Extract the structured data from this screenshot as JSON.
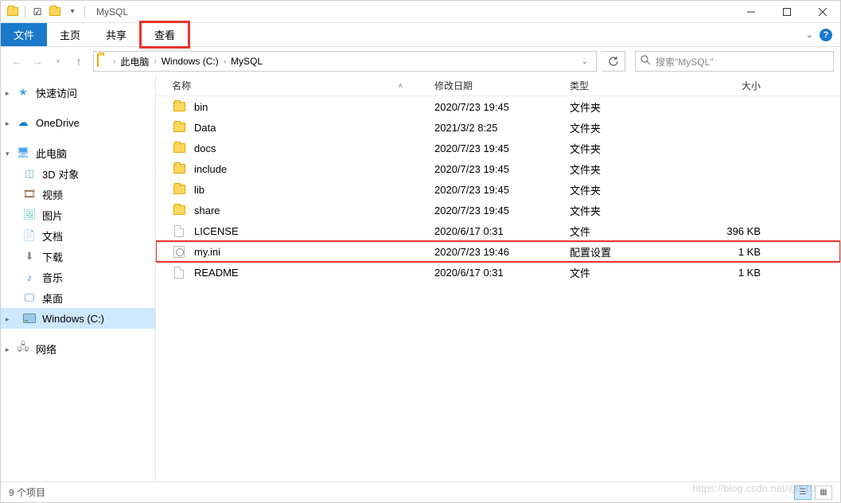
{
  "window": {
    "title": "MySQL"
  },
  "ribbon": {
    "file": "文件",
    "home": "主页",
    "share": "共享",
    "view": "查看"
  },
  "breadcrumb": {
    "segments": [
      "此电脑",
      "Windows  (C:)",
      "MySQL"
    ]
  },
  "search": {
    "placeholder": "搜索\"MySQL\""
  },
  "navpane": {
    "quick_access": "快速访问",
    "onedrive": "OneDrive",
    "this_pc": "此电脑",
    "objects_3d": "3D 对象",
    "videos": "视频",
    "pictures": "图片",
    "documents": "文档",
    "downloads": "下载",
    "music": "音乐",
    "desktop": "桌面",
    "drive_c": "Windows  (C:)",
    "network": "网络"
  },
  "columns": {
    "name": "名称",
    "date": "修改日期",
    "type": "类型",
    "size": "大小"
  },
  "files": [
    {
      "name": "bin",
      "date": "2020/7/23 19:45",
      "type": "文件夹",
      "size": "",
      "icon": "folder"
    },
    {
      "name": "Data",
      "date": "2021/3/2 8:25",
      "type": "文件夹",
      "size": "",
      "icon": "folder"
    },
    {
      "name": "docs",
      "date": "2020/7/23 19:45",
      "type": "文件夹",
      "size": "",
      "icon": "folder"
    },
    {
      "name": "include",
      "date": "2020/7/23 19:45",
      "type": "文件夹",
      "size": "",
      "icon": "folder"
    },
    {
      "name": "lib",
      "date": "2020/7/23 19:45",
      "type": "文件夹",
      "size": "",
      "icon": "folder"
    },
    {
      "name": "share",
      "date": "2020/7/23 19:45",
      "type": "文件夹",
      "size": "",
      "icon": "folder"
    },
    {
      "name": "LICENSE",
      "date": "2020/6/17 0:31",
      "type": "文件",
      "size": "396 KB",
      "icon": "file"
    },
    {
      "name": "my.ini",
      "date": "2020/7/23 19:46",
      "type": "配置设置",
      "size": "1 KB",
      "icon": "ini",
      "highlighted": true
    },
    {
      "name": "README",
      "date": "2020/6/17 0:31",
      "type": "文件",
      "size": "1 KB",
      "icon": "file"
    }
  ],
  "status": {
    "item_count": "9 个项目"
  },
  "watermark": "https://blog.csdn.net/@510..."
}
